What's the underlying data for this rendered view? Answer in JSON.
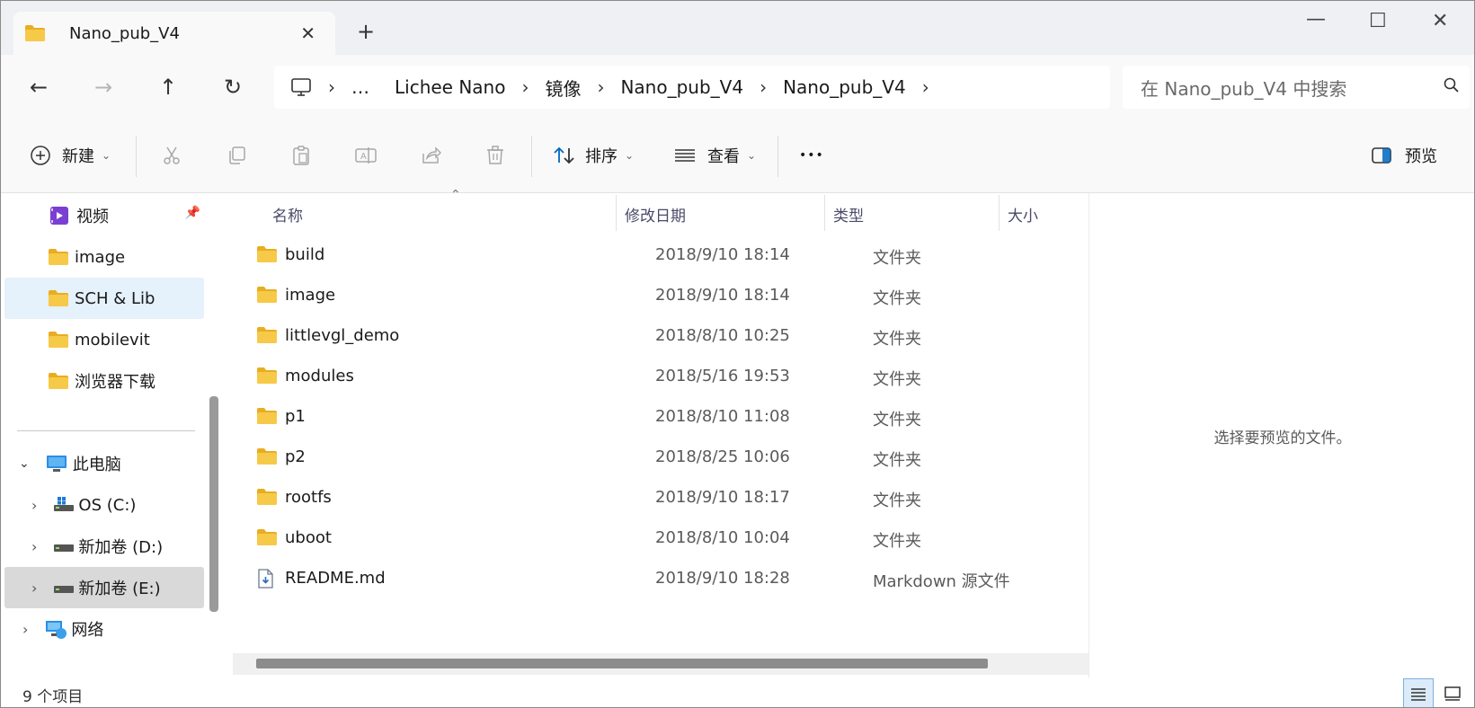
{
  "tab": {
    "title": "Nano_pub_V4",
    "close_glyph": "✕",
    "new_glyph": "+"
  },
  "window_controls": {
    "minimize": "—",
    "maximize": "☐",
    "close": "✕"
  },
  "nav": {
    "back": "←",
    "forward": "→",
    "up": "↑",
    "refresh": "↻",
    "breadcrumb": [
      "…",
      "Lichee Nano",
      "镜像",
      "Nano_pub_V4",
      "Nano_pub_V4"
    ],
    "sep": "›",
    "search_placeholder": "在 Nano_pub_V4 中搜索"
  },
  "commands": {
    "new_label": "新建",
    "sort_label": "排序",
    "view_label": "查看",
    "more_label": "•••",
    "preview_label": "预览"
  },
  "sidebar": {
    "quick": [
      {
        "label": "视频",
        "icon": "video-folder-icon",
        "pinned": true
      },
      {
        "label": "image",
        "icon": "folder-icon"
      },
      {
        "label": "SCH & Lib",
        "icon": "folder-icon"
      },
      {
        "label": "mobilevit",
        "icon": "folder-icon"
      },
      {
        "label": "浏览器下载",
        "icon": "folder-icon"
      }
    ],
    "pc_label": "此电脑",
    "drives": [
      {
        "label": "OS (C:)",
        "icon": "windows-drive-icon"
      },
      {
        "label": "新加卷 (D:)",
        "icon": "drive-icon"
      },
      {
        "label": "新加卷 (E:)",
        "icon": "drive-icon"
      }
    ],
    "network_label": "网络"
  },
  "columns": {
    "name": "名称",
    "date": "修改日期",
    "type": "类型",
    "size": "大小"
  },
  "files": [
    {
      "name": "build",
      "date": "2018/9/10 18:14",
      "type": "文件夹",
      "icon": "folder-icon"
    },
    {
      "name": "image",
      "date": "2018/9/10 18:14",
      "type": "文件夹",
      "icon": "folder-icon"
    },
    {
      "name": "littlevgl_demo",
      "date": "2018/8/10 10:25",
      "type": "文件夹",
      "icon": "folder-icon"
    },
    {
      "name": "modules",
      "date": "2018/5/16 19:53",
      "type": "文件夹",
      "icon": "folder-icon"
    },
    {
      "name": "p1",
      "date": "2018/8/10 11:08",
      "type": "文件夹",
      "icon": "folder-icon"
    },
    {
      "name": "p2",
      "date": "2018/8/25 10:06",
      "type": "文件夹",
      "icon": "folder-icon"
    },
    {
      "name": "rootfs",
      "date": "2018/9/10 18:17",
      "type": "文件夹",
      "icon": "folder-icon"
    },
    {
      "name": "uboot",
      "date": "2018/8/10 10:04",
      "type": "文件夹",
      "icon": "folder-icon"
    },
    {
      "name": "README.md",
      "date": "2018/9/10 18:28",
      "type": "Markdown 源文件",
      "icon": "markdown-file-icon"
    }
  ],
  "preview_message": "选择要预览的文件。",
  "status": {
    "count": "9 个项目"
  },
  "colors": {
    "folder": "#f7c948",
    "folder_dark": "#e8ad21",
    "accent": "#0067c0",
    "selected_bg": "#e5f1fb"
  }
}
